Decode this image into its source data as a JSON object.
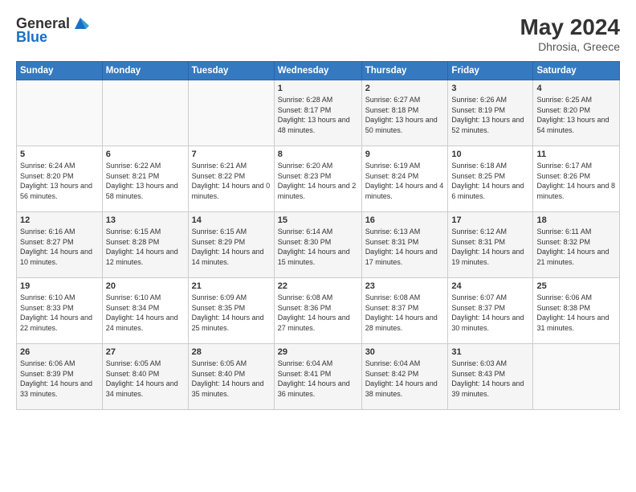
{
  "header": {
    "logo_general": "General",
    "logo_blue": "Blue",
    "month": "May 2024",
    "location": "Dhrosia, Greece"
  },
  "days": [
    "Sunday",
    "Monday",
    "Tuesday",
    "Wednesday",
    "Thursday",
    "Friday",
    "Saturday"
  ],
  "weeks": [
    [
      {
        "date": "",
        "sunrise": "",
        "sunset": "",
        "daylight": ""
      },
      {
        "date": "",
        "sunrise": "",
        "sunset": "",
        "daylight": ""
      },
      {
        "date": "",
        "sunrise": "",
        "sunset": "",
        "daylight": ""
      },
      {
        "date": "1",
        "sunrise": "Sunrise: 6:28 AM",
        "sunset": "Sunset: 8:17 PM",
        "daylight": "Daylight: 13 hours and 48 minutes."
      },
      {
        "date": "2",
        "sunrise": "Sunrise: 6:27 AM",
        "sunset": "Sunset: 8:18 PM",
        "daylight": "Daylight: 13 hours and 50 minutes."
      },
      {
        "date": "3",
        "sunrise": "Sunrise: 6:26 AM",
        "sunset": "Sunset: 8:19 PM",
        "daylight": "Daylight: 13 hours and 52 minutes."
      },
      {
        "date": "4",
        "sunrise": "Sunrise: 6:25 AM",
        "sunset": "Sunset: 8:20 PM",
        "daylight": "Daylight: 13 hours and 54 minutes."
      }
    ],
    [
      {
        "date": "5",
        "sunrise": "Sunrise: 6:24 AM",
        "sunset": "Sunset: 8:20 PM",
        "daylight": "Daylight: 13 hours and 56 minutes."
      },
      {
        "date": "6",
        "sunrise": "Sunrise: 6:22 AM",
        "sunset": "Sunset: 8:21 PM",
        "daylight": "Daylight: 13 hours and 58 minutes."
      },
      {
        "date": "7",
        "sunrise": "Sunrise: 6:21 AM",
        "sunset": "Sunset: 8:22 PM",
        "daylight": "Daylight: 14 hours and 0 minutes."
      },
      {
        "date": "8",
        "sunrise": "Sunrise: 6:20 AM",
        "sunset": "Sunset: 8:23 PM",
        "daylight": "Daylight: 14 hours and 2 minutes."
      },
      {
        "date": "9",
        "sunrise": "Sunrise: 6:19 AM",
        "sunset": "Sunset: 8:24 PM",
        "daylight": "Daylight: 14 hours and 4 minutes."
      },
      {
        "date": "10",
        "sunrise": "Sunrise: 6:18 AM",
        "sunset": "Sunset: 8:25 PM",
        "daylight": "Daylight: 14 hours and 6 minutes."
      },
      {
        "date": "11",
        "sunrise": "Sunrise: 6:17 AM",
        "sunset": "Sunset: 8:26 PM",
        "daylight": "Daylight: 14 hours and 8 minutes."
      }
    ],
    [
      {
        "date": "12",
        "sunrise": "Sunrise: 6:16 AM",
        "sunset": "Sunset: 8:27 PM",
        "daylight": "Daylight: 14 hours and 10 minutes."
      },
      {
        "date": "13",
        "sunrise": "Sunrise: 6:15 AM",
        "sunset": "Sunset: 8:28 PM",
        "daylight": "Daylight: 14 hours and 12 minutes."
      },
      {
        "date": "14",
        "sunrise": "Sunrise: 6:15 AM",
        "sunset": "Sunset: 8:29 PM",
        "daylight": "Daylight: 14 hours and 14 minutes."
      },
      {
        "date": "15",
        "sunrise": "Sunrise: 6:14 AM",
        "sunset": "Sunset: 8:30 PM",
        "daylight": "Daylight: 14 hours and 15 minutes."
      },
      {
        "date": "16",
        "sunrise": "Sunrise: 6:13 AM",
        "sunset": "Sunset: 8:31 PM",
        "daylight": "Daylight: 14 hours and 17 minutes."
      },
      {
        "date": "17",
        "sunrise": "Sunrise: 6:12 AM",
        "sunset": "Sunset: 8:31 PM",
        "daylight": "Daylight: 14 hours and 19 minutes."
      },
      {
        "date": "18",
        "sunrise": "Sunrise: 6:11 AM",
        "sunset": "Sunset: 8:32 PM",
        "daylight": "Daylight: 14 hours and 21 minutes."
      }
    ],
    [
      {
        "date": "19",
        "sunrise": "Sunrise: 6:10 AM",
        "sunset": "Sunset: 8:33 PM",
        "daylight": "Daylight: 14 hours and 22 minutes."
      },
      {
        "date": "20",
        "sunrise": "Sunrise: 6:10 AM",
        "sunset": "Sunset: 8:34 PM",
        "daylight": "Daylight: 14 hours and 24 minutes."
      },
      {
        "date": "21",
        "sunrise": "Sunrise: 6:09 AM",
        "sunset": "Sunset: 8:35 PM",
        "daylight": "Daylight: 14 hours and 25 minutes."
      },
      {
        "date": "22",
        "sunrise": "Sunrise: 6:08 AM",
        "sunset": "Sunset: 8:36 PM",
        "daylight": "Daylight: 14 hours and 27 minutes."
      },
      {
        "date": "23",
        "sunrise": "Sunrise: 6:08 AM",
        "sunset": "Sunset: 8:37 PM",
        "daylight": "Daylight: 14 hours and 28 minutes."
      },
      {
        "date": "24",
        "sunrise": "Sunrise: 6:07 AM",
        "sunset": "Sunset: 8:37 PM",
        "daylight": "Daylight: 14 hours and 30 minutes."
      },
      {
        "date": "25",
        "sunrise": "Sunrise: 6:06 AM",
        "sunset": "Sunset: 8:38 PM",
        "daylight": "Daylight: 14 hours and 31 minutes."
      }
    ],
    [
      {
        "date": "26",
        "sunrise": "Sunrise: 6:06 AM",
        "sunset": "Sunset: 8:39 PM",
        "daylight": "Daylight: 14 hours and 33 minutes."
      },
      {
        "date": "27",
        "sunrise": "Sunrise: 6:05 AM",
        "sunset": "Sunset: 8:40 PM",
        "daylight": "Daylight: 14 hours and 34 minutes."
      },
      {
        "date": "28",
        "sunrise": "Sunrise: 6:05 AM",
        "sunset": "Sunset: 8:40 PM",
        "daylight": "Daylight: 14 hours and 35 minutes."
      },
      {
        "date": "29",
        "sunrise": "Sunrise: 6:04 AM",
        "sunset": "Sunset: 8:41 PM",
        "daylight": "Daylight: 14 hours and 36 minutes."
      },
      {
        "date": "30",
        "sunrise": "Sunrise: 6:04 AM",
        "sunset": "Sunset: 8:42 PM",
        "daylight": "Daylight: 14 hours and 38 minutes."
      },
      {
        "date": "31",
        "sunrise": "Sunrise: 6:03 AM",
        "sunset": "Sunset: 8:43 PM",
        "daylight": "Daylight: 14 hours and 39 minutes."
      },
      {
        "date": "",
        "sunrise": "",
        "sunset": "",
        "daylight": ""
      }
    ]
  ]
}
